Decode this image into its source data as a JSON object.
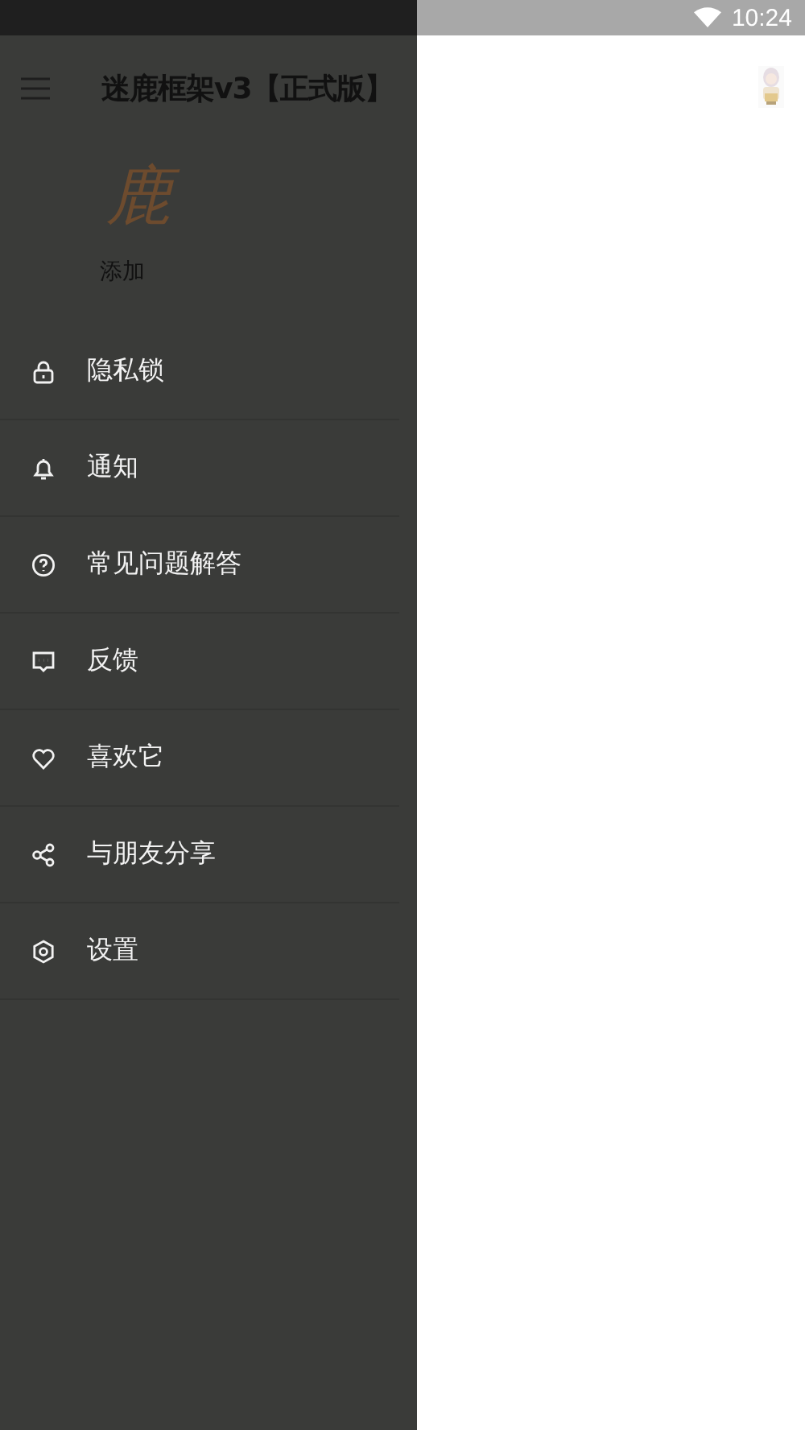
{
  "status_bar": {
    "time": "10:24"
  },
  "app_bar": {
    "title": "迷鹿框架v3【正式版】"
  },
  "drawer": {
    "logo": "鹿",
    "add_label": "添加",
    "items": [
      {
        "kind": "lock",
        "label": "隐私锁"
      },
      {
        "kind": "bell",
        "label": "通知"
      },
      {
        "kind": "help",
        "label": "常见问题解答"
      },
      {
        "kind": "feedback",
        "label": "反馈"
      },
      {
        "kind": "heart",
        "label": "喜欢它"
      },
      {
        "kind": "share",
        "label": "与朋友分享"
      },
      {
        "kind": "settings",
        "label": "设置"
      }
    ]
  }
}
